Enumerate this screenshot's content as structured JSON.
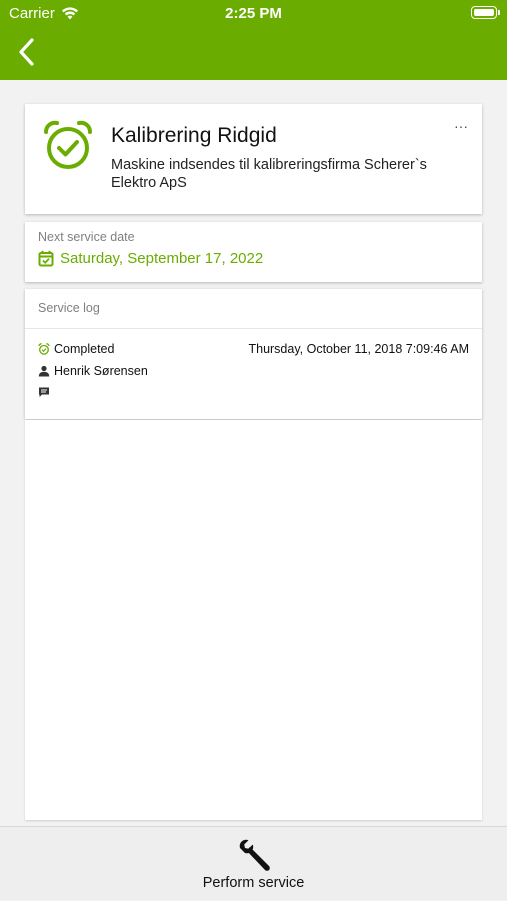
{
  "status_bar": {
    "carrier": "Carrier",
    "time": "2:25 PM"
  },
  "colors": {
    "brand_green": "#6aad00",
    "background": "#f2f2f2",
    "muted_text": "#808080"
  },
  "task": {
    "title": "Kalibrering Ridgid",
    "description": "Maskine indsendes til kalibreringsfirma Scherer`s Elektro ApS",
    "more_label": "···",
    "icon": "alarm-clock-check-icon"
  },
  "next_service": {
    "label": "Next service date",
    "date": "Saturday, September 17, 2022",
    "icon": "calendar-check-icon"
  },
  "service_log": {
    "title": "Service log",
    "entries": [
      {
        "status": "Completed",
        "status_icon": "alarm-clock-icon",
        "date": "Thursday, October 11, 2018 7:09:46 AM",
        "user": "Henrik Sørensen",
        "user_icon": "person-icon",
        "comment_icon": "comment-icon"
      }
    ]
  },
  "bottom_bar": {
    "action_label": "Perform service",
    "action_icon": "wrench-icon"
  }
}
